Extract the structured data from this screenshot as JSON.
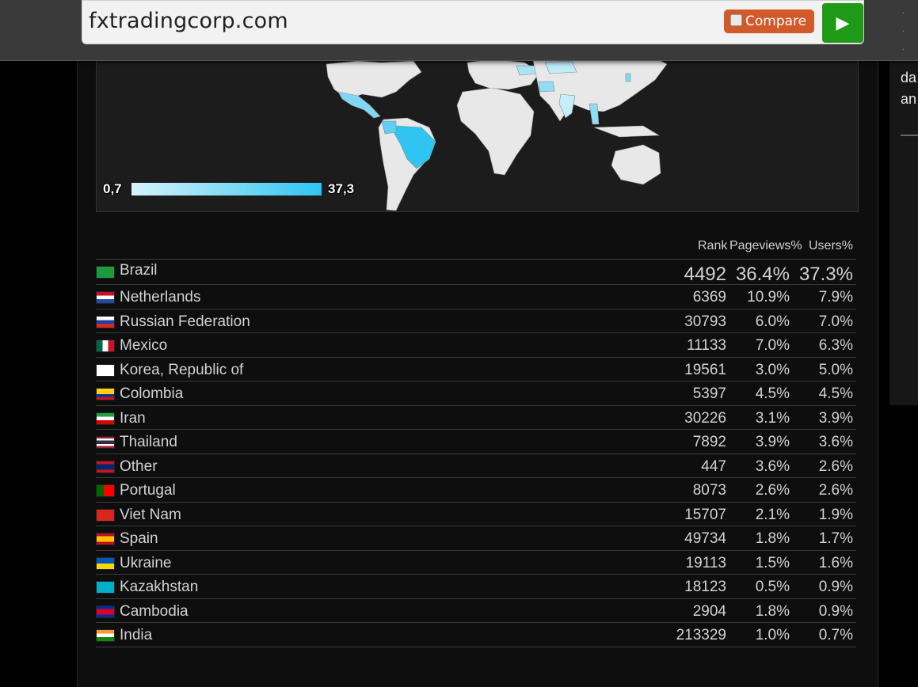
{
  "search": {
    "url": "fxtradingcorp.com",
    "compare_label": "Compare",
    "go_icon": "play-icon"
  },
  "right_panel": {
    "line1": "da",
    "line2": "an",
    "bullets": [
      "·",
      "·",
      "·"
    ]
  },
  "map": {
    "legend_min": "0,7",
    "legend_max": "37,3",
    "low_color": "#d7f3fb",
    "high_color": "#2fc4f2"
  },
  "table": {
    "headers": {
      "rank": "Rank",
      "pageviews": "Pageviews%",
      "users": "Users%"
    },
    "rows": [
      {
        "country": "Brazil",
        "flag": "brazil-flag-icon",
        "rank": "4492",
        "pageviews": "36.4%",
        "users": "37.3%"
      },
      {
        "country": "Netherlands",
        "flag": "netherlands-flag-icon",
        "rank": "6369",
        "pageviews": "10.9%",
        "users": "7.9%"
      },
      {
        "country": "Russian Federation",
        "flag": "russia-flag-icon",
        "rank": "30793",
        "pageviews": "6.0%",
        "users": "7.0%"
      },
      {
        "country": "Mexico",
        "flag": "mexico-flag-icon",
        "rank": "11133",
        "pageviews": "7.0%",
        "users": "6.3%"
      },
      {
        "country": "Korea, Republic of",
        "flag": "korea-flag-icon",
        "rank": "19561",
        "pageviews": "3.0%",
        "users": "5.0%"
      },
      {
        "country": "Colombia",
        "flag": "colombia-flag-icon",
        "rank": "5397",
        "pageviews": "4.5%",
        "users": "4.5%"
      },
      {
        "country": "Iran",
        "flag": "iran-flag-icon",
        "rank": "30226",
        "pageviews": "3.1%",
        "users": "3.9%"
      },
      {
        "country": "Thailand",
        "flag": "thailand-flag-icon",
        "rank": "7892",
        "pageviews": "3.9%",
        "users": "3.6%"
      },
      {
        "country": "Other",
        "flag": "other-flag-icon",
        "rank": "447",
        "pageviews": "3.6%",
        "users": "2.6%"
      },
      {
        "country": "Portugal",
        "flag": "portugal-flag-icon",
        "rank": "8073",
        "pageviews": "2.6%",
        "users": "2.6%"
      },
      {
        "country": "Viet Nam",
        "flag": "vietnam-flag-icon",
        "rank": "15707",
        "pageviews": "2.1%",
        "users": "1.9%"
      },
      {
        "country": "Spain",
        "flag": "spain-flag-icon",
        "rank": "49734",
        "pageviews": "1.8%",
        "users": "1.7%"
      },
      {
        "country": "Ukraine",
        "flag": "ukraine-flag-icon",
        "rank": "19113",
        "pageviews": "1.5%",
        "users": "1.6%"
      },
      {
        "country": "Kazakhstan",
        "flag": "kazakhstan-flag-icon",
        "rank": "18123",
        "pageviews": "0.5%",
        "users": "0.9%"
      },
      {
        "country": "Cambodia",
        "flag": "cambodia-flag-icon",
        "rank": "2904",
        "pageviews": "1.8%",
        "users": "0.9%"
      },
      {
        "country": "India",
        "flag": "india-flag-icon",
        "rank": "213329",
        "pageviews": "1.0%",
        "users": "0.7%"
      }
    ]
  }
}
